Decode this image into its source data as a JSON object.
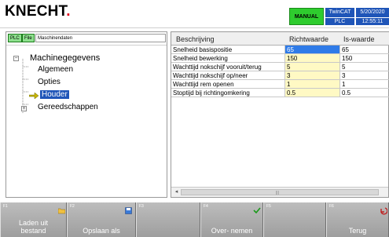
{
  "header": {
    "logo_text": "KNECHT",
    "logo_dot": ".",
    "mode": "MANUAL",
    "twincat_top": "TwinCAT",
    "twincat_bottom": "PLC",
    "date": "5/20/2020",
    "time": "12:55:11"
  },
  "left_panel": {
    "plc_button": "PLC",
    "file_button": "File",
    "breadcrumb": "Maschinendaten"
  },
  "tree": {
    "root": "Machinegegevens",
    "items": [
      "Algemeen",
      "Opties",
      "Houder",
      "Gereedschappen"
    ],
    "selected": "Houder"
  },
  "table": {
    "headers": [
      "Beschrijving",
      "Richtwaarde",
      "Is-waarde"
    ],
    "rows": [
      {
        "desc": "Snelheid basispositie",
        "target": "65",
        "actual": "65"
      },
      {
        "desc": "Snelheid bewerking",
        "target": "150",
        "actual": "150"
      },
      {
        "desc": "Wachttijd nokschijf vooruit/terug",
        "target": "5",
        "actual": "5"
      },
      {
        "desc": "Wachttijd nokschijf op/neer",
        "target": "3",
        "actual": "3"
      },
      {
        "desc": "Wachttijd rem openen",
        "target": "1",
        "actual": "1"
      },
      {
        "desc": "Stoptijd bij richtingomkering",
        "target": "0.5",
        "actual": "0.5"
      }
    ]
  },
  "fkeys": [
    {
      "num": "F1",
      "label_line1": "Laden uit",
      "label_line2": "bestand"
    },
    {
      "num": "F2",
      "label_line1": "Opslaan als",
      "label_line2": ""
    },
    {
      "num": "F3",
      "label_line1": "",
      "label_line2": ""
    },
    {
      "num": "F4",
      "label_line1": "Over- nemen",
      "label_line2": ""
    },
    {
      "num": "F5",
      "label_line1": "",
      "label_line2": ""
    },
    {
      "num": "F6",
      "label_line1": "Terug",
      "label_line2": ""
    }
  ],
  "colors": {
    "accent_blue": "#1f55b8",
    "manual_green": "#2ecc2e",
    "logo_red": "#e2001a",
    "selected_cell": "#2f7be8",
    "editable_cell": "#fff9c4"
  }
}
